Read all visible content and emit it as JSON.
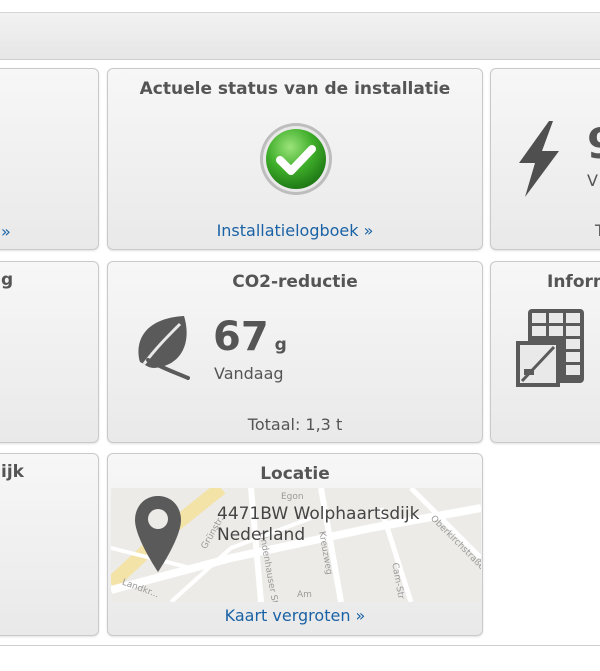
{
  "status_card": {
    "title": "Actuele status van de installatie",
    "status_icon": "check-circle-icon",
    "status_color": "#3fae2a",
    "link": "Installatielogboek »"
  },
  "co2_card": {
    "title": "CO2-reductie",
    "value": "67",
    "unit": "g",
    "period": "Vandaag",
    "total": "Totaal: 1,3 t",
    "icon": "leaf-icon"
  },
  "location_card": {
    "title": "Locatie",
    "address_line1": "4471BW Wolphaartsdijk",
    "address_line2": "Nederland",
    "link": "Kaart vergroten »",
    "icon": "map-pin-icon",
    "street_labels": [
      "Egon",
      "Grünstr.",
      "Lindenhauser Str.",
      "Kreuzweg",
      "Am",
      "Oberkirchstraße",
      "Cam-Str",
      "Landkr..."
    ]
  },
  "left_column": {
    "row1_link": "»",
    "row2_title": "g",
    "row3_title": "ijk"
  },
  "right_column": {
    "power_value": "9",
    "power_sub": "V",
    "power_tail": "T",
    "info_title": "Inform",
    "power_icon": "lightning-bolt-icon",
    "info_icon": "solar-panel-icon"
  },
  "colors": {
    "link": "#1a62a5",
    "card_border": "#c9c9c9"
  }
}
